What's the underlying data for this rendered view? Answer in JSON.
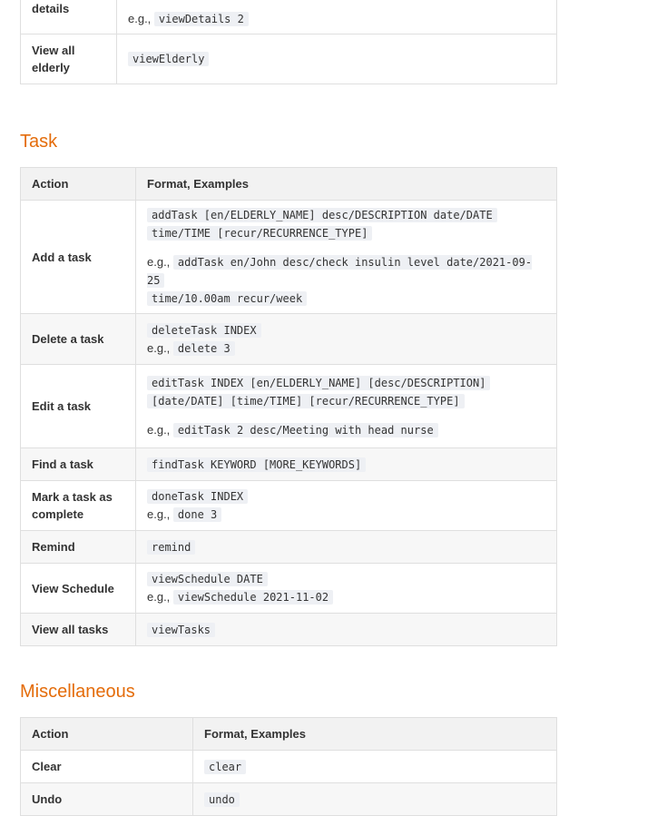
{
  "elderly_section": {
    "rows": [
      {
        "action": "details",
        "lines": [],
        "example": "viewDetails 2"
      },
      {
        "action": "View all elderly",
        "lines": [
          "viewElderly"
        ],
        "example": ""
      }
    ]
  },
  "eg_label": "e.g.,",
  "task_section": {
    "heading": "Task",
    "col_action": "Action",
    "col_format": "Format, Examples",
    "rows": [
      {
        "action": "Add a task",
        "lines": [
          "addTask [en/ELDERLY_NAME] desc/DESCRIPTION date/DATE",
          "time/TIME [recur/RECURRENCE_TYPE]"
        ],
        "example_lines": [
          "addTask en/John desc/check insulin level date/2021-09-25",
          "time/10.00am recur/week"
        ]
      },
      {
        "action": "Delete a task",
        "lines": [
          "deleteTask INDEX"
        ],
        "example_lines": [
          "delete 3"
        ]
      },
      {
        "action": "Edit a task",
        "lines": [
          "editTask INDEX [en/ELDERLY_NAME] [desc/DESCRIPTION]",
          "[date/DATE] [time/TIME] [recur/RECURRENCE_TYPE]"
        ],
        "example_lines": [
          "editTask 2 desc/Meeting with head nurse"
        ]
      },
      {
        "action": "Find a task",
        "lines": [
          "findTask KEYWORD [MORE_KEYWORDS]"
        ],
        "example_lines": []
      },
      {
        "action": "Mark a task as complete",
        "lines": [
          "doneTask INDEX"
        ],
        "example_lines": [
          "done 3"
        ]
      },
      {
        "action": "Remind",
        "lines": [
          "remind"
        ],
        "example_lines": []
      },
      {
        "action": "View Schedule",
        "lines": [
          "viewSchedule DATE"
        ],
        "example_lines": [
          "viewSchedule 2021-11-02"
        ]
      },
      {
        "action": "View all tasks",
        "lines": [
          "viewTasks"
        ],
        "example_lines": []
      }
    ]
  },
  "misc_section": {
    "heading": "Miscellaneous",
    "col_action": "Action",
    "col_format": "Format, Examples",
    "rows": [
      {
        "action": "Clear",
        "lines": [
          "clear"
        ]
      },
      {
        "action": "Undo",
        "lines": [
          "undo"
        ]
      }
    ]
  }
}
